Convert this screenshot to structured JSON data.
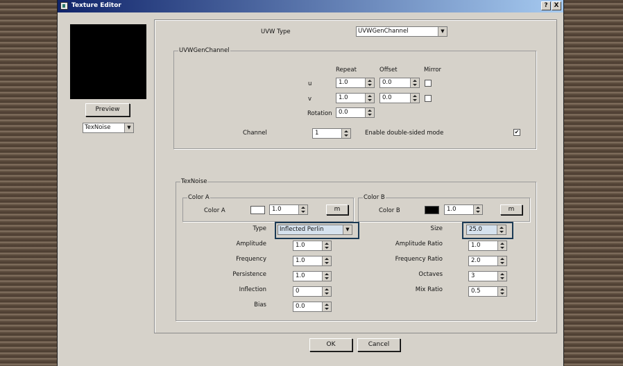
{
  "window": {
    "title": "Texture Editor",
    "help_label": "?",
    "close_label": "X"
  },
  "left": {
    "preview_label": "Preview",
    "texture_select": "TexNoise"
  },
  "uvw": {
    "type_label": "UVW Type",
    "type_value": "UVWGenChannel",
    "group_title": "UVWGenChannel",
    "col_repeat": "Repeat",
    "col_offset": "Offset",
    "col_mirror": "Mirror",
    "u_label": "u",
    "v_label": "v",
    "u_repeat": "1.0",
    "u_offset": "0.0",
    "v_repeat": "1.0",
    "v_offset": "0.0",
    "u_mirror": false,
    "v_mirror": false,
    "rotation_label": "Rotation",
    "rotation_value": "0.0",
    "channel_label": "Channel",
    "channel_value": "1",
    "double_sided_label": "Enable double-sided mode",
    "double_sided_checked": true
  },
  "texnoise": {
    "group_title": "TexNoise",
    "color_a": {
      "group_title": "Color A",
      "label": "Color A",
      "swatch_color": "#ffffff",
      "value": "1.0",
      "map_label": "m"
    },
    "color_b": {
      "group_title": "Color B",
      "label": "Color B",
      "swatch_color": "#000000",
      "value": "1.0",
      "map_label": "m"
    },
    "type_label": "Type",
    "type_value": "Inflected Perlin",
    "size_label": "Size",
    "size_value": "25.0",
    "amplitude_label": "Amplitude",
    "amplitude_value": "1.0",
    "amplitude_ratio_label": "Amplitude Ratio",
    "amplitude_ratio_value": "1.0",
    "frequency_label": "Frequency",
    "frequency_value": "1.0",
    "frequency_ratio_label": "Frequency Ratio",
    "frequency_ratio_value": "2.0",
    "persistence_label": "Persistence",
    "persistence_value": "1.0",
    "octaves_label": "Octaves",
    "octaves_value": "3",
    "inflection_label": "Inflection",
    "inflection_value": "0",
    "mix_ratio_label": "Mix Ratio",
    "mix_ratio_value": "0.5",
    "bias_label": "Bias",
    "bias_value": "0.0"
  },
  "footer": {
    "ok_label": "OK",
    "cancel_label": "Cancel"
  },
  "colors": {
    "titlebar_start": "#10246a",
    "titlebar_end": "#a6caf0",
    "dialog_bg": "#d6d2ca",
    "highlight": "#1b3a55"
  }
}
